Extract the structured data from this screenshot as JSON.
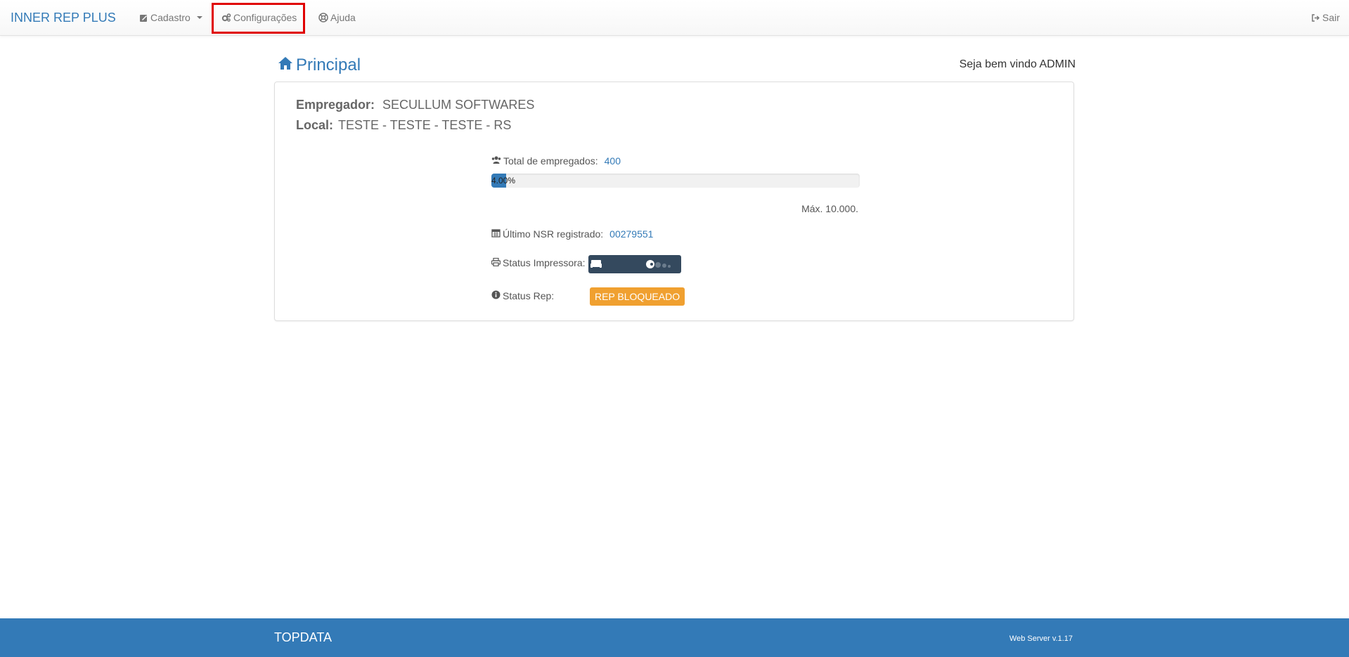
{
  "navbar": {
    "brand": "INNER REP PLUS",
    "items": [
      {
        "label": "Cadastro",
        "icon": "edit-icon"
      },
      {
        "label": "Configurações",
        "icon": "cogs-icon"
      },
      {
        "label": "Ajuda",
        "icon": "lifebuoy-icon"
      }
    ],
    "logout_label": "Sair"
  },
  "header": {
    "title": "Principal",
    "welcome": "Seja bem vindo ADMIN"
  },
  "panel": {
    "employer_label": "Empregador:",
    "employer_value": "SECULLUM SOFTWARES",
    "location_label": "Local:",
    "location_value": "TESTE - TESTE - TESTE - RS",
    "total_employees_label": "Total de empregados:",
    "total_employees_value": "400",
    "progress_percent": 4.0,
    "progress_text": "4.00%",
    "max_text": "Máx. 10.000.",
    "last_nsr_label": "Último NSR registrado:",
    "last_nsr_value": "00279551",
    "printer_status_label": "Status Impressora:",
    "rep_status_label": "Status Rep:",
    "rep_status_value": "REP BLOQUEADO"
  },
  "footer": {
    "brand": "TOPDATA",
    "version": "Web Server v.1.17"
  },
  "colors": {
    "primary": "#337ab7",
    "warning": "#f0a030",
    "printer_badge": "#34495e",
    "highlight": "#e00000"
  }
}
